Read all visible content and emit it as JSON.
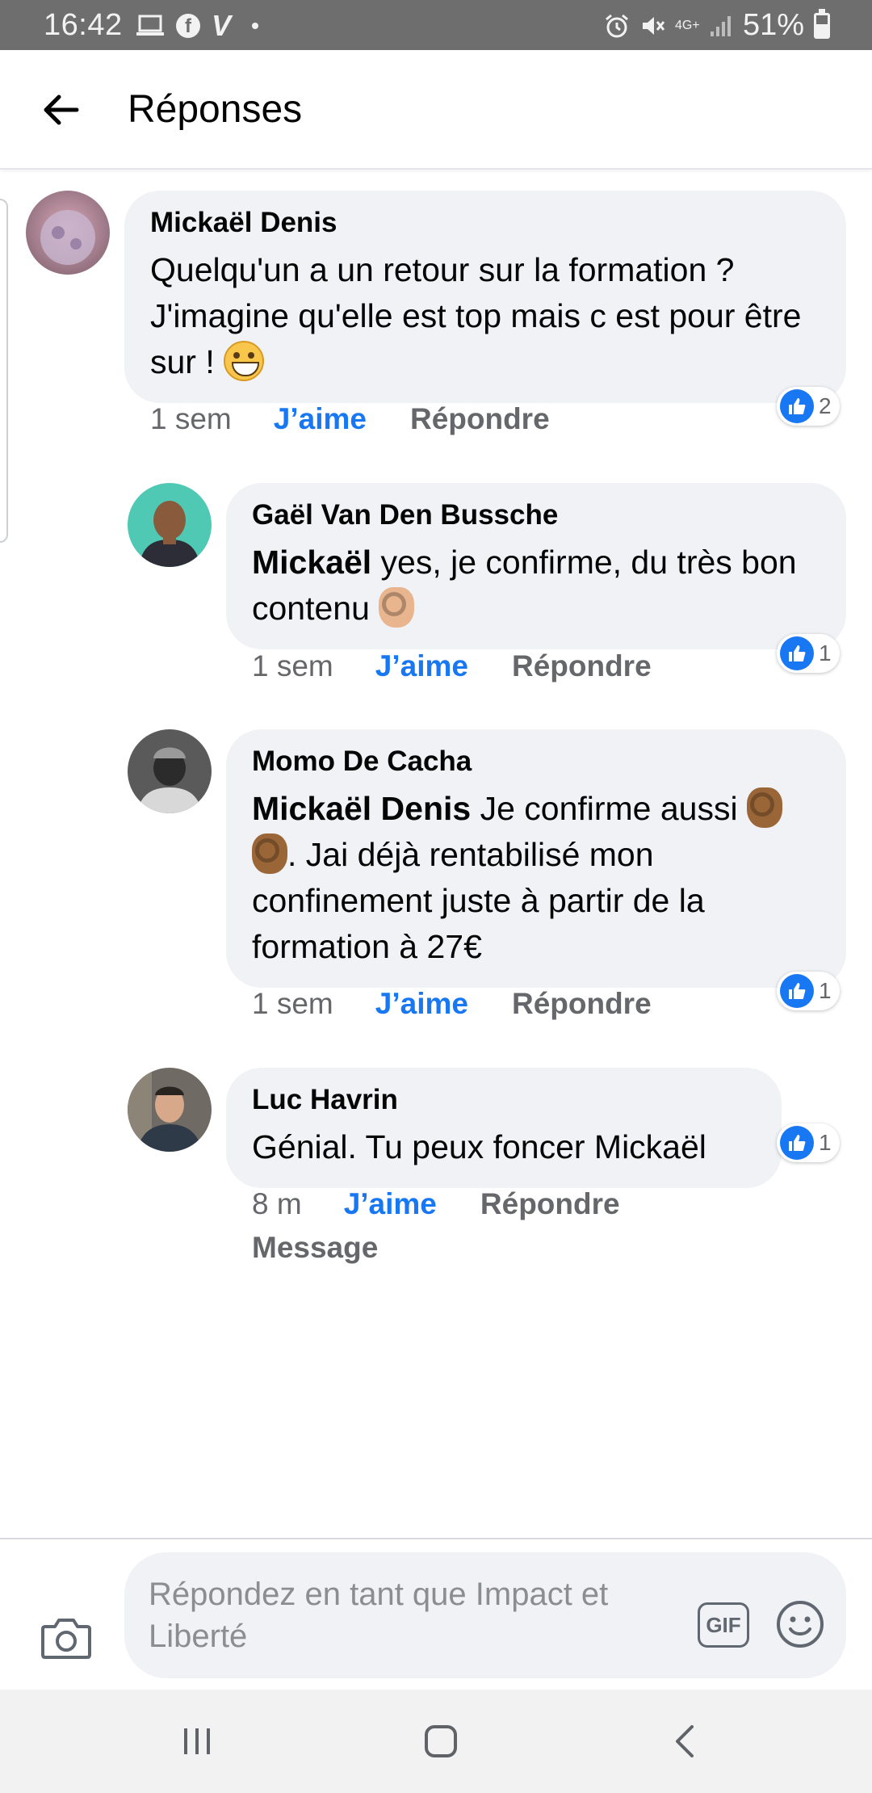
{
  "status_bar": {
    "time": "16:42",
    "battery": "51%",
    "network": "4G+",
    "left_icons": [
      "laptop-icon",
      "facebook-icon",
      "vimeo-icon",
      "dot-icon"
    ],
    "right_icons": [
      "alarm-icon",
      "mute-icon",
      "network-4g-icon",
      "signal-icon",
      "battery-icon"
    ]
  },
  "header": {
    "title": "Réponses",
    "back_icon": "arrow-left-icon"
  },
  "comments": [
    {
      "author": "Mickaël Denis",
      "mention": "",
      "text": "Quelqu'un a un retour sur la formation ? J'imagine qu'elle est top mais c est pour être sur !",
      "emoji": "grinning-face-emoji",
      "time": "1 sem",
      "like": "J’aime",
      "reply": "Répondre",
      "reactions": "2"
    },
    {
      "author": "Gaël Van Den Bussche",
      "mention": "Mickaël",
      "text": " yes, je confirme, du très bon contenu ",
      "emoji": "ok-hand-emoji",
      "time": "1 sem",
      "like": "J’aime",
      "reply": "Répondre",
      "reactions": "1"
    },
    {
      "author": "Momo De Cacha",
      "mention": "Mickaël Denis",
      "text_before": " Je confirme aussi ",
      "text_after": ". Jai déjà rentabilisé mon confinement juste à partir de la formation à 27€",
      "emoji": "ok-hand-emoji",
      "time": "1 sem",
      "like": "J’aime",
      "reply": "Répondre",
      "reactions": "1"
    },
    {
      "author": "Luc Havrin",
      "mention": "",
      "text": "Génial. Tu peux foncer Mickaël",
      "time": "8 m",
      "like": "J’aime",
      "reply": "Répondre",
      "extra": "Message",
      "reactions": "1"
    }
  ],
  "composer": {
    "placeholder": "Répondez en tant que Impact et Liberté",
    "gif_label": "GIF",
    "camera_icon": "camera-icon",
    "emoji_icon": "smiley-icon"
  },
  "nav_bar": {
    "icons": [
      "recent-apps-icon",
      "home-icon",
      "back-icon"
    ]
  },
  "colors": {
    "like_blue": "#1877f2",
    "bubble_bg": "#f0f2f5",
    "meta_gray": "#65676b",
    "status_bar_bg": "#6e6e6e"
  }
}
